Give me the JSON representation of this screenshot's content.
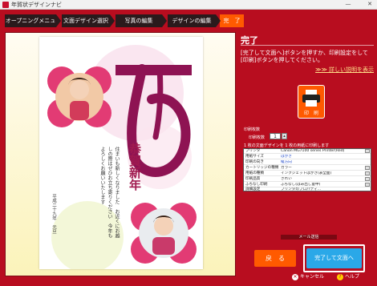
{
  "window": {
    "title": "年賀状デザインナビ",
    "min_glyph": "—",
    "close_glyph": "✕"
  },
  "steps": [
    {
      "label": "オープニングメニュー",
      "active": false
    },
    {
      "label": "文面デザイン選択",
      "active": false
    },
    {
      "label": "写真の編集",
      "active": false
    },
    {
      "label": "デザインの編集",
      "active": false
    },
    {
      "label": "完　了",
      "active": true
    }
  ],
  "card": {
    "greeting": "恭賀新年",
    "message": "住まいも新しくなりました　お近くにお越しの際はぜひお立ち寄りください　今年もよろしくお願いいたします",
    "date": "平成二十九年　元旦",
    "kanji": "酉"
  },
  "panel": {
    "title": "完了",
    "description": "[完了して文面へ]ボタンを押すか、印刷設定をして[印刷]ボタンを押してください。",
    "detail_link": "≫≫ 詳しい説明を表示",
    "print_label": "印　刷",
    "copies_heading": "印刷枚数",
    "copies_label": "印刷枚数",
    "copies_value": "1",
    "settings_heading": "1 枚の文面デザインを 1 枚の用紙に印刷します",
    "settings": [
      {
        "key": "プリンタ",
        "value": "Canon MG7100 series Printer(Red)",
        "blue": false
      },
      {
        "key": "用紙サイズ",
        "value": "はがき",
        "blue": true
      },
      {
        "key": "印刷の向き",
        "value": "縦方向",
        "blue": true
      },
      {
        "key": "カートリッジの種類",
        "value": "カラー",
        "blue": false
      },
      {
        "key": "用紙の種類",
        "value": "インクジェットはがき(表全面)",
        "blue": false
      },
      {
        "key": "印刷品質",
        "value": "きれい",
        "blue": false
      },
      {
        "key": "ふちなし印刷",
        "value": "ふちなし(はみ出し量中)",
        "blue": false
      },
      {
        "key": "詳細設定",
        "value": "プリンタのプロパティ...",
        "blue": false
      }
    ],
    "mail_label": "メール送信",
    "back_label": "戻　る",
    "finish_label": "完了して文面へ",
    "cancel_label": "キャンセル",
    "help_label": "ヘルプ"
  },
  "colors": {
    "frame_red": "#b80d1f",
    "accent_orange": "#ff5a00",
    "finish_blue": "#2aa8e8",
    "kanji_magenta": "#8e1353"
  }
}
